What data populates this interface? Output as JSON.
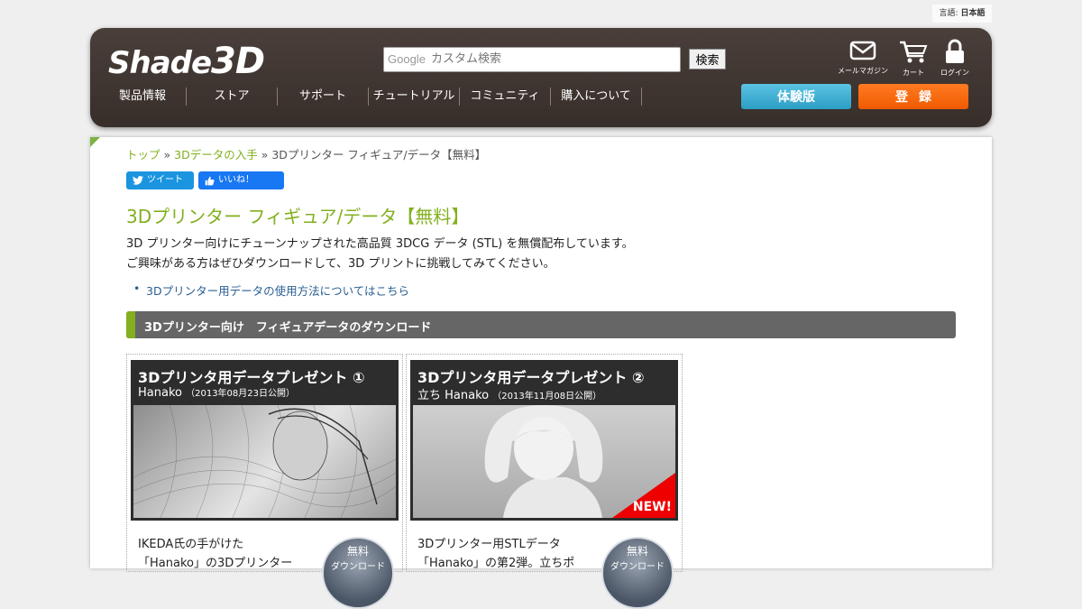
{
  "lang": {
    "label": "言語:",
    "value": "日本語"
  },
  "header": {
    "logo_main": "Shade",
    "logo_big": "3D",
    "search_placeholder": "カスタム検索",
    "search_brand": "Google",
    "search_button": "検索",
    "icons": [
      {
        "name": "mail-icon",
        "label": "メールマガジン"
      },
      {
        "name": "cart-icon",
        "label": "カート"
      },
      {
        "name": "lock-icon",
        "label": "ログイン"
      }
    ],
    "nav": [
      "製品情報",
      "ストア",
      "サポート",
      "チュートリアル",
      "コミュニティ",
      "購入について"
    ],
    "trial_button": "体験版",
    "register_button": "登録",
    "colors": {
      "header_bg": "#3d3430",
      "trial": "#2c9ec4",
      "register": "#f05a00",
      "accent": "#82b01f"
    }
  },
  "breadcrumb": {
    "home": "トップ",
    "sep": "»",
    "level2": "3Dデータの入手",
    "current": "3Dプリンター フィギュア/データ【無料】"
  },
  "social": {
    "tweet": "ツイート",
    "like": "いいね！"
  },
  "title": "3Dプリンター フィギュア/データ【無料】",
  "description": [
    "3D プリンター向けにチューンナップされた高品質 3DCG データ (STL) を無償配布しています。",
    "ご興味がある方はぜひダウンロードして、3D プリントに挑戦してみてください。"
  ],
  "link": "3Dプリンター用データの使用方法についてはこちら",
  "section": "3Dプリンター向け　フィギュアデータのダウンロード",
  "cards": [
    {
      "title": "3Dプリンタ用データプレゼント ①",
      "name": "Hanako",
      "date": "（2013年08月23日公開）",
      "text": [
        "IKEDA氏の手がけた",
        "「Hanako」の3Dプリンター"
      ],
      "dl1": "無料",
      "dl2": "ダウンロード",
      "new": ""
    },
    {
      "title": "3Dプリンタ用データプレゼント ②",
      "name": "立ち Hanako",
      "date": "（2013年11月08日公開）",
      "text": [
        "3Dプリンター用STLデータ",
        "「Hanako」の第2弾。立ちポ"
      ],
      "dl1": "無料",
      "dl2": "ダウンロード",
      "new": "NEW!"
    }
  ]
}
